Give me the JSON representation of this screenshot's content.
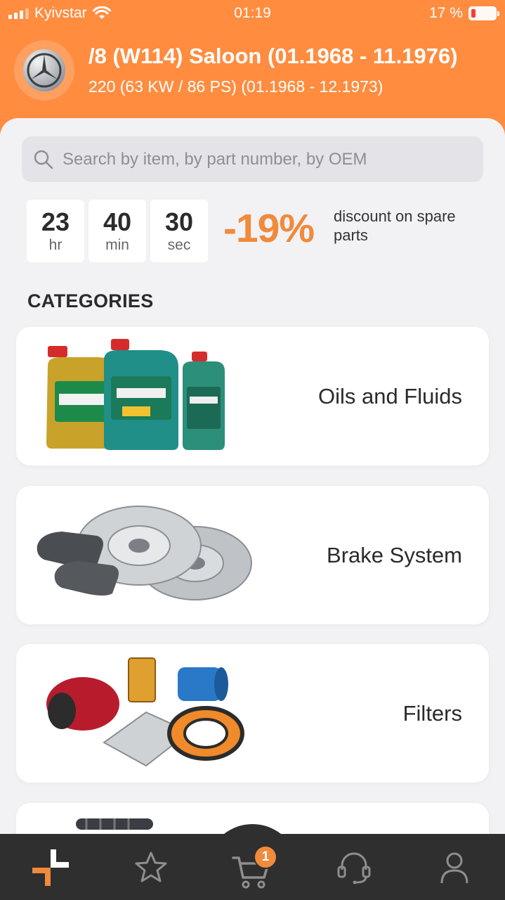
{
  "status_bar": {
    "carrier": "Kyivstar",
    "time": "01:19",
    "battery": "17 %"
  },
  "vehicle": {
    "title": "/8 (W114) Saloon (01.1968 - 11.1976)",
    "subtitle": "220 (63 KW / 86 PS) (01.1968 - 12.1973)",
    "logo_icon": "mercedes-logo"
  },
  "search": {
    "placeholder": "Search by item, by part number, by OEM",
    "value": ""
  },
  "promo": {
    "timer": [
      {
        "value": "23",
        "unit": "hr"
      },
      {
        "value": "40",
        "unit": "min"
      },
      {
        "value": "30",
        "unit": "sec"
      }
    ],
    "discount": "-19%",
    "discount_text": "discount on spare parts"
  },
  "categories_title": "CATEGORIES",
  "categories": [
    {
      "label": "Oils and Fluids",
      "icon": "oil-bottles-image"
    },
    {
      "label": "Brake System",
      "icon": "brake-discs-image"
    },
    {
      "label": "Filters",
      "icon": "filters-image"
    }
  ],
  "bottom_nav": {
    "items": [
      "home-icon",
      "star-icon",
      "cart-icon",
      "support-icon",
      "profile-icon"
    ],
    "cart_badge": "1"
  },
  "colors": {
    "accent": "#ff8c3f",
    "discount": "#f08a3c",
    "nav_bg": "#2f2f2f"
  }
}
